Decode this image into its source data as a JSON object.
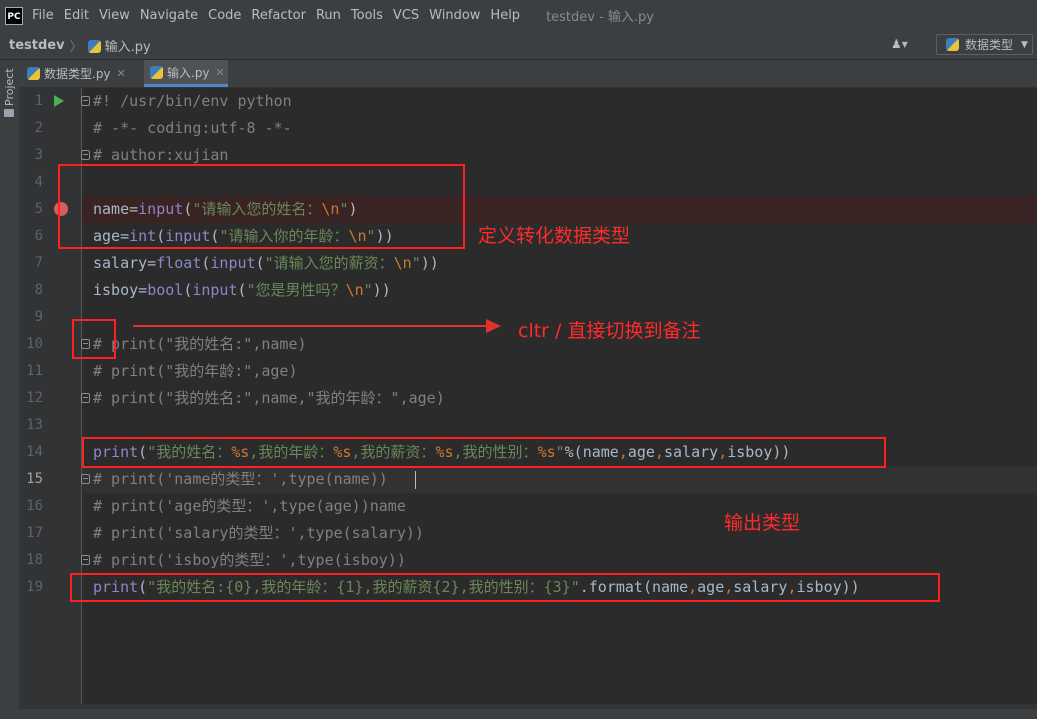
{
  "menubar": {
    "logo": "PC",
    "items": [
      "File",
      "Edit",
      "View",
      "Navigate",
      "Code",
      "Refactor",
      "Run",
      "Tools",
      "VCS",
      "Window",
      "Help"
    ],
    "window_title": "testdev - 输入.py"
  },
  "navbar": {
    "project": "testdev",
    "file": "输入.py",
    "run_config": "数据类型"
  },
  "side_panel": {
    "project_label": "Project"
  },
  "tabs": [
    {
      "label": "数据类型.py",
      "active": false
    },
    {
      "label": "输入.py",
      "active": true
    }
  ],
  "editor": {
    "lines": [
      {
        "num": "1"
      },
      {
        "num": "2"
      },
      {
        "num": "3"
      },
      {
        "num": "4"
      },
      {
        "num": "5"
      },
      {
        "num": "6"
      },
      {
        "num": "7"
      },
      {
        "num": "8"
      },
      {
        "num": "9"
      },
      {
        "num": "10"
      },
      {
        "num": "11"
      },
      {
        "num": "12"
      },
      {
        "num": "13"
      },
      {
        "num": "14"
      },
      {
        "num": "15"
      },
      {
        "num": "16"
      },
      {
        "num": "17"
      },
      {
        "num": "18"
      },
      {
        "num": "19"
      }
    ],
    "code": {
      "l1": "#! /usr/bin/env python",
      "l2": "# -*- coding:utf-8 -*-",
      "l3": "# author:xujian",
      "l5": {
        "a": "name=",
        "b": "input",
        "c": "(",
        "d": "\"请输入您的姓名：",
        "e": "\\n",
        "f": "\"",
        "g": ")"
      },
      "l6": {
        "a": "age=",
        "b": "int",
        "c": "(",
        "d": "input",
        "e": "(",
        "f": "\"请输入你的年龄：",
        "g": "\\n",
        "h": "\"",
        "i": "))"
      },
      "l7": {
        "a": "salary=",
        "b": "float",
        "c": "(",
        "d": "input",
        "e": "(",
        "f": "\"请输入您的薪资：",
        "g": "\\n",
        "h": "\"",
        "i": "))"
      },
      "l8": {
        "a": "isboy=",
        "b": "bool",
        "c": "(",
        "d": "input",
        "e": "(",
        "f": "\"您是男性吗？",
        "g": "\\n",
        "h": "\"",
        "i": "))"
      },
      "l10": "# print(\"我的姓名:\",name)",
      "l11": "# print(\"我的年龄:\",age)",
      "l12": "# print(\"我的姓名:\",name,\"我的年龄：\",age)",
      "l14": {
        "a": "print",
        "b": "(",
        "c": "\"我的姓名：",
        "d": "%s",
        "e": ",我的年龄：",
        "f": "%s",
        "g": ",我的薪资：",
        "h": "%s",
        "i": ",我的性别：",
        "j": "%s",
        "k": "\"",
        "l": "%(name",
        "m": ",",
        "n": "age",
        "o": ",",
        "p": "salary",
        "q": ",",
        "r": "isboy))"
      },
      "l15": "# print('name的类型：',type(name))",
      "l16": "# print('age的类型：',type(age))name",
      "l17": "# print('salary的类型：',type(salary))",
      "l18": "# print('isboy的类型：',type(isboy))",
      "l19": {
        "a": "print",
        "b": "(",
        "c": "\"我的姓名:{0},我的年龄：{1},我的薪资{2},我的性别：{3}\"",
        "d": ".format(name",
        "e": ",",
        "f": "age",
        "g": ",",
        "h": "salary",
        "i": ",",
        "j": "isboy))"
      }
    }
  },
  "annotations": {
    "define_types": "定义转化数据类型",
    "shortcut": "cltr /  直接切换到备注",
    "output_types": "输出类型"
  },
  "colors": {
    "annotation": "#ff2020",
    "editor_bg": "#2b2b2b",
    "keyword": "#cc7832",
    "string": "#6a8759",
    "builtin": "#8888c6",
    "comment": "#808080"
  }
}
